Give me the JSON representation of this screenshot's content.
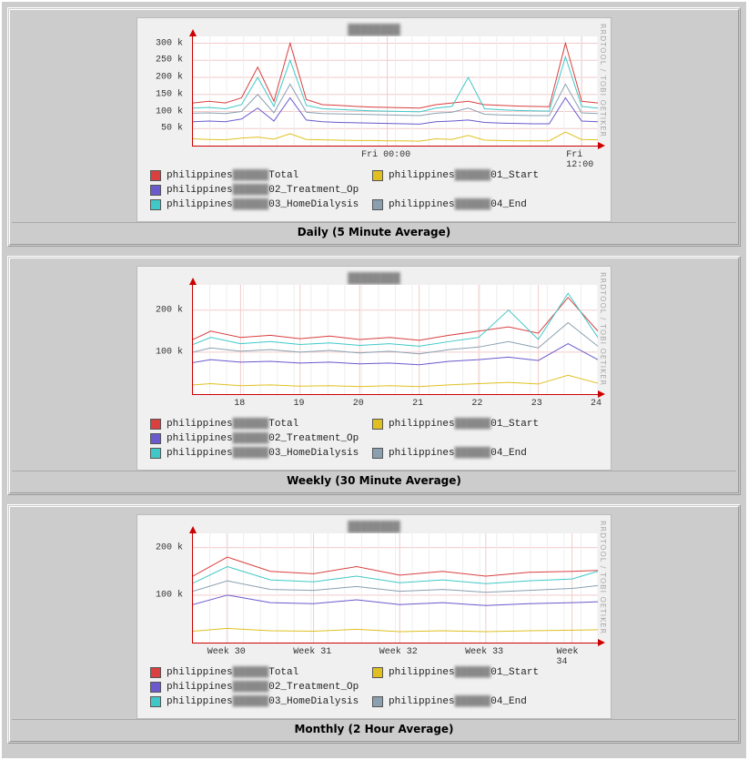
{
  "rrd_credit": "RRDTOOL / TOBI OETIKER",
  "chart_obscured_title": "████████",
  "legend_obscured": "██████",
  "series_defs": [
    {
      "key": "Total",
      "color": "#d94040"
    },
    {
      "key": "01_Start",
      "color": "#e0c020"
    },
    {
      "key": "02_Treatment_Op",
      "color": "#6a5acd"
    },
    {
      "key": "03_HomeDialysis",
      "color": "#40c8c8"
    },
    {
      "key": "04_End",
      "color": "#8aa0b0"
    }
  ],
  "legend_prefix": "philippines",
  "panels": [
    {
      "id": "daily",
      "caption": "Daily (5 Minute Average)"
    },
    {
      "id": "weekly",
      "caption": "Weekly (30 Minute Average)"
    },
    {
      "id": "monthly",
      "caption": "Monthly (2 Hour Average)"
    }
  ],
  "chart_data": [
    {
      "id": "daily",
      "type": "line",
      "title": "",
      "xlabel": "",
      "ylabel": "",
      "ylim": [
        0,
        320000
      ],
      "yticks": [
        50000,
        100000,
        150000,
        200000,
        250000,
        300000
      ],
      "ytick_labels": [
        "50 k",
        "100 k",
        "150 k",
        "200 k",
        "250 k",
        "300 k"
      ],
      "x": [
        -12,
        -11,
        -10,
        -9,
        -8,
        -7,
        -6,
        -5,
        -4,
        -3,
        -2,
        -1,
        0,
        1,
        2,
        3,
        4,
        5,
        6,
        7,
        8,
        9,
        10,
        11,
        12,
        13
      ],
      "xtick_positions": [
        0,
        12
      ],
      "xtick_labels": [
        "Fri 00:00",
        "Fri 12:00"
      ],
      "series": [
        {
          "name": "Total",
          "color": "#d94040",
          "values": [
            125,
            130,
            125,
            140,
            230,
            130,
            300,
            135,
            120,
            118,
            115,
            113,
            112,
            111,
            110,
            120,
            125,
            130,
            120,
            118,
            116,
            115,
            114,
            300,
            130,
            125
          ]
        },
        {
          "name": "01_Start",
          "color": "#e0c020",
          "values": [
            20,
            18,
            17,
            22,
            25,
            19,
            35,
            18,
            17,
            16,
            15,
            15,
            14,
            14,
            13,
            20,
            18,
            30,
            16,
            15,
            14,
            14,
            14,
            40,
            18,
            17
          ]
        },
        {
          "name": "02_Treatment_Op",
          "color": "#6a5acd",
          "values": [
            70,
            72,
            70,
            78,
            110,
            72,
            140,
            75,
            70,
            68,
            67,
            66,
            65,
            64,
            63,
            70,
            72,
            75,
            68,
            66,
            65,
            64,
            64,
            140,
            72,
            70
          ]
        },
        {
          "name": "03_HomeDialysis",
          "color": "#40c8c8",
          "values": [
            110,
            112,
            108,
            120,
            200,
            115,
            250,
            118,
            108,
            106,
            104,
            102,
            101,
            100,
            99,
            110,
            115,
            200,
            108,
            105,
            103,
            102,
            101,
            260,
            115,
            110
          ]
        },
        {
          "name": "04_End",
          "color": "#8aa0b0",
          "values": [
            95,
            96,
            94,
            100,
            150,
            96,
            180,
            98,
            94,
            93,
            92,
            91,
            90,
            89,
            88,
            95,
            98,
            110,
            92,
            90,
            89,
            88,
            88,
            180,
            96,
            94
          ]
        }
      ]
    },
    {
      "id": "weekly",
      "type": "line",
      "title": "",
      "xlabel": "",
      "ylabel": "",
      "ylim": [
        0,
        260000
      ],
      "yticks": [
        100000,
        200000
      ],
      "ytick_labels": [
        "100 k",
        "200 k"
      ],
      "x": [
        17.2,
        17.5,
        18,
        18.5,
        19,
        19.5,
        20,
        20.5,
        21,
        21.5,
        22,
        22.5,
        23,
        23.5,
        24
      ],
      "xtick_positions": [
        18,
        19,
        20,
        21,
        22,
        23,
        24
      ],
      "xtick_labels": [
        "18",
        "19",
        "20",
        "21",
        "22",
        "23",
        "24"
      ],
      "series": [
        {
          "name": "Total",
          "color": "#d94040",
          "values": [
            130,
            150,
            135,
            140,
            132,
            138,
            130,
            135,
            128,
            140,
            150,
            160,
            145,
            230,
            150
          ]
        },
        {
          "name": "01_Start",
          "color": "#e0c020",
          "values": [
            22,
            25,
            20,
            22,
            19,
            20,
            18,
            20,
            18,
            22,
            25,
            28,
            24,
            45,
            26
          ]
        },
        {
          "name": "02_Treatment_Op",
          "color": "#6a5acd",
          "values": [
            75,
            82,
            76,
            78,
            74,
            76,
            72,
            74,
            70,
            78,
            82,
            88,
            80,
            120,
            82
          ]
        },
        {
          "name": "03_HomeDialysis",
          "color": "#40c8c8",
          "values": [
            118,
            135,
            120,
            125,
            118,
            122,
            116,
            120,
            114,
            125,
            135,
            200,
            130,
            240,
            135
          ]
        },
        {
          "name": "04_End",
          "color": "#8aa0b0",
          "values": [
            100,
            110,
            102,
            106,
            100,
            104,
            98,
            102,
            96,
            106,
            112,
            125,
            110,
            170,
            114
          ]
        }
      ]
    },
    {
      "id": "monthly",
      "type": "line",
      "title": "",
      "xlabel": "",
      "ylabel": "",
      "ylim": [
        0,
        230000
      ],
      "yticks": [
        100000,
        200000
      ],
      "ytick_labels": [
        "100 k",
        "200 k"
      ],
      "x": [
        29.6,
        30,
        30.5,
        31,
        31.5,
        32,
        32.5,
        33,
        33.5,
        34,
        34.3
      ],
      "xtick_positions": [
        30,
        31,
        32,
        33,
        34
      ],
      "xtick_labels": [
        "Week 30",
        "Week 31",
        "Week 32",
        "Week 33",
        "Week 34"
      ],
      "series": [
        {
          "name": "Total",
          "color": "#d94040",
          "values": [
            140,
            180,
            150,
            145,
            160,
            142,
            150,
            140,
            148,
            150,
            152
          ]
        },
        {
          "name": "01_Start",
          "color": "#e0c020",
          "values": [
            24,
            30,
            25,
            24,
            28,
            23,
            25,
            23,
            25,
            26,
            27
          ]
        },
        {
          "name": "02_Treatment_Op",
          "color": "#6a5acd",
          "values": [
            80,
            100,
            84,
            82,
            90,
            80,
            84,
            78,
            82,
            84,
            86
          ]
        },
        {
          "name": "03_HomeDialysis",
          "color": "#40c8c8",
          "values": [
            125,
            160,
            132,
            128,
            140,
            126,
            132,
            124,
            130,
            134,
            150
          ]
        },
        {
          "name": "04_End",
          "color": "#8aa0b0",
          "values": [
            108,
            130,
            112,
            110,
            118,
            108,
            112,
            106,
            110,
            114,
            120
          ]
        }
      ]
    }
  ]
}
